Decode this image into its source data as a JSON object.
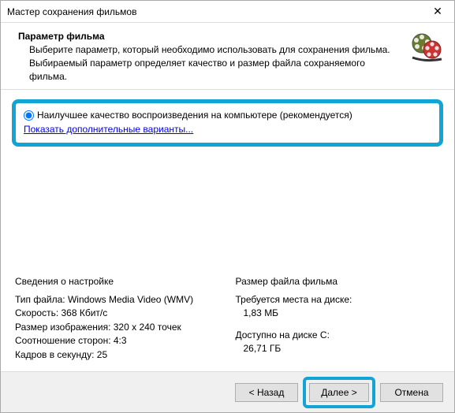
{
  "window": {
    "title": "Мастер сохранения фильмов"
  },
  "header": {
    "title": "Параметр фильма",
    "desc": "Выберите параметр, который необходимо использовать для сохранения фильма. Выбираемый параметр определяет качество и размер файла сохраняемого фильма."
  },
  "option": {
    "radio_label": "Наилучшее качество воспроизведения на компьютере (рекомендуется)",
    "link": "Показать дополнительные варианты..."
  },
  "settings": {
    "heading": "Сведения о настройке",
    "file_type_label": "Тип файла:",
    "file_type_value": "Windows Media Video (WMV)",
    "bitrate_label": "Скорость:",
    "bitrate_value": "368 Кбит/с",
    "resolution_label": "Размер изображения:",
    "resolution_value": "320 x 240 точек",
    "aspect_label": "Соотношение сторон:",
    "aspect_value": "4:3",
    "fps_label": "Кадров в секунду:",
    "fps_value": "25"
  },
  "filesize": {
    "heading": "Размер файла фильма",
    "required_label": "Требуется места на диске:",
    "required_value": "1,83 МБ",
    "available_label": "Доступно на диске C:",
    "available_value": "26,71 ГБ"
  },
  "buttons": {
    "back": "< Назад",
    "next": "Далее >",
    "cancel": "Отмена"
  }
}
